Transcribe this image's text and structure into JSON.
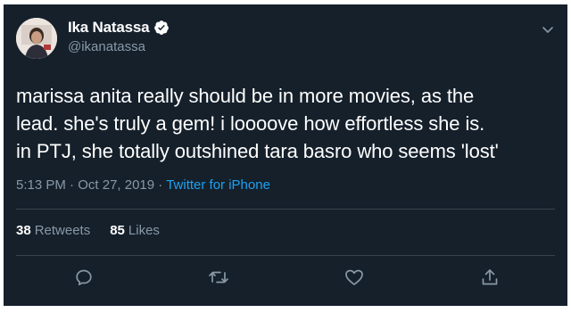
{
  "tweet": {
    "author": {
      "display_name": "Ika Natassa",
      "handle": "@ikanatassa",
      "verified": true
    },
    "text": "marissa anita really should be in more movies, as the\nlead. she's truly a gem! i loooove how effortless she is.\nin PTJ, she totally outshined tara basro who seems 'lost'",
    "time": "5:13 PM",
    "separator": "·",
    "date": "Oct 27, 2019",
    "source": "Twitter for iPhone",
    "stats": {
      "retweets_count": "38",
      "retweets_label": "Retweets",
      "likes_count": "85",
      "likes_label": "Likes"
    },
    "icons": {
      "menu": "chevron-down-icon",
      "reply": "reply-icon",
      "retweet": "retweet-icon",
      "like": "heart-icon",
      "share": "share-icon"
    }
  },
  "colors": {
    "background": "#15202b",
    "text": "#ffffff",
    "secondary": "#8899a6",
    "accent": "#1da1f2",
    "divider": "#38444d"
  }
}
